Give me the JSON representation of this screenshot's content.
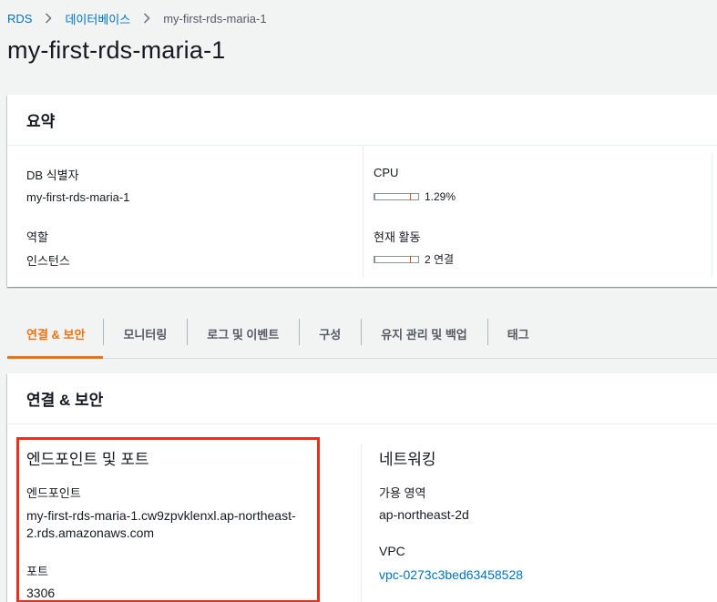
{
  "breadcrumb": {
    "items": [
      "RDS",
      "데이터베이스",
      "my-first-rds-maria-1"
    ]
  },
  "page_title": "my-first-rds-maria-1",
  "summary": {
    "header": "요약",
    "db_identifier_label": "DB 식별자",
    "db_identifier_value": "my-first-rds-maria-1",
    "role_label": "역할",
    "role_value": "인스턴스",
    "cpu_label": "CPU",
    "cpu_value": "1.29%",
    "cpu_fraction": 0.0129,
    "activity_label": "현재 활동",
    "activity_value": "2 연결",
    "activity_fraction": 0.02
  },
  "tabs": [
    {
      "label": "연결 & 보안",
      "active": true
    },
    {
      "label": "모니터링",
      "active": false
    },
    {
      "label": "로그 및 이벤트",
      "active": false
    },
    {
      "label": "구성",
      "active": false
    },
    {
      "label": "유지 관리 및 백업",
      "active": false
    },
    {
      "label": "태그",
      "active": false
    }
  ],
  "connectivity": {
    "header": "연결 & 보안",
    "endpoint_section_title": "엔드포인트 및 포트",
    "endpoint_label": "엔드포인트",
    "endpoint_line1": "my-first-rds-maria-1.cw9zpvklenxl.ap-northeast-",
    "endpoint_line2": "2.rds.amazonaws.com",
    "port_label": "포트",
    "port_value": "3306",
    "network_section_title": "네트워킹",
    "az_label": "가용 영역",
    "az_value": "ap-northeast-2d",
    "vpc_label": "VPC",
    "vpc_value": "vpc-0273c3bed63458528"
  },
  "colors": {
    "accent": "#ec7211",
    "link": "#0073bb",
    "highlight": "#e8301c"
  }
}
